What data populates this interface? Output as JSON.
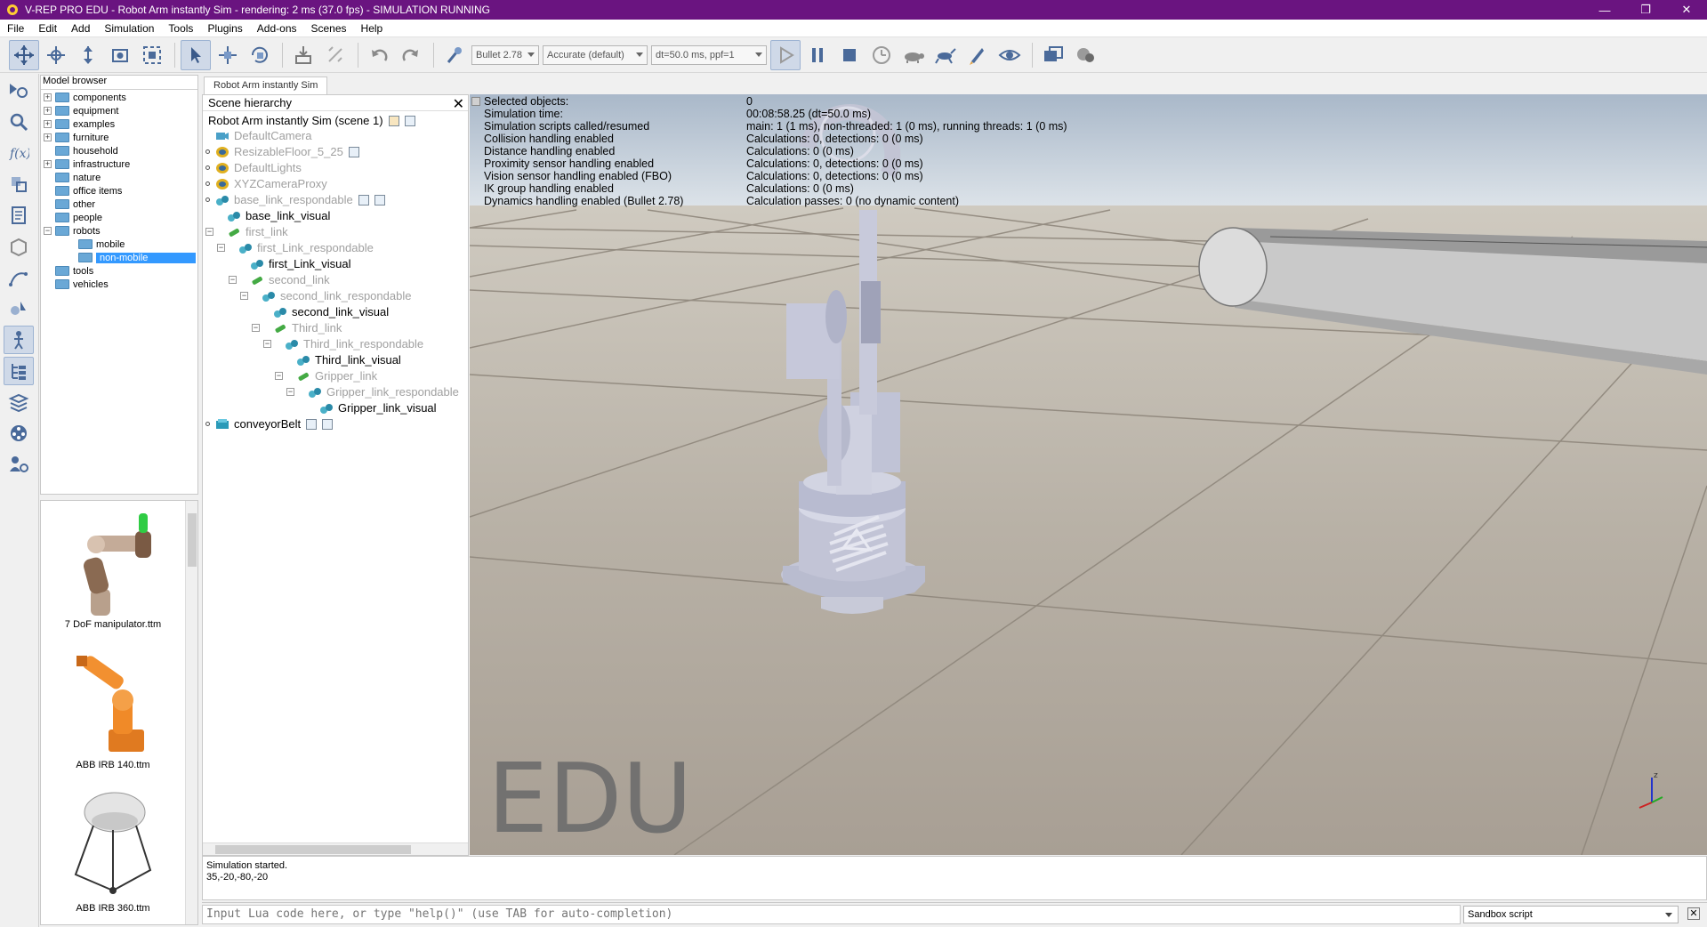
{
  "window": {
    "title": "V-REP PRO EDU - Robot Arm instantly Sim - rendering: 2 ms (37.0 fps) - SIMULATION RUNNING",
    "title_bar_color": "#6a1480"
  },
  "menu": {
    "items": [
      "File",
      "Edit",
      "Add",
      "Simulation",
      "Tools",
      "Plugins",
      "Add-ons",
      "Scenes",
      "Help"
    ]
  },
  "toolbar": {
    "engine": "Bullet 2.78",
    "accuracy": "Accurate (default)",
    "timestep": "dt=50.0 ms, ppf=1"
  },
  "model_browser": {
    "title": "Model browser",
    "folders": [
      {
        "label": "components",
        "expandable": true
      },
      {
        "label": "equipment",
        "expandable": true
      },
      {
        "label": "examples",
        "expandable": true
      },
      {
        "label": "furniture",
        "expandable": true
      },
      {
        "label": "household",
        "expandable": false
      },
      {
        "label": "infrastructure",
        "expandable": true
      },
      {
        "label": "nature",
        "expandable": false
      },
      {
        "label": "office items",
        "expandable": false
      },
      {
        "label": "other",
        "expandable": false
      },
      {
        "label": "people",
        "expandable": false
      },
      {
        "label": "robots",
        "expandable": true,
        "expanded": true
      },
      {
        "label": "mobile",
        "child": true
      },
      {
        "label": "non-mobile",
        "child": true,
        "selected": true
      },
      {
        "label": "tools",
        "expandable": false
      },
      {
        "label": "vehicles",
        "expandable": false
      }
    ],
    "thumbnails": [
      "7 DoF manipulator.ttm",
      "ABB IRB 140.ttm",
      "ABB IRB 360.ttm"
    ]
  },
  "scene": {
    "tab": "Robot Arm instantly Sim",
    "hierarchy_title": "Scene hierarchy",
    "root": "Robot Arm instantly Sim (scene 1)",
    "items": [
      {
        "label": "DefaultCamera",
        "dim": true
      },
      {
        "label": "ResizableFloor_5_25",
        "dim": true
      },
      {
        "label": "DefaultLights",
        "dim": true
      },
      {
        "label": "XYZCameraProxy",
        "dim": true
      },
      {
        "label": "base_link_respondable",
        "dim": true
      },
      {
        "label": "base_link_visual",
        "dim": false
      },
      {
        "label": "first_link",
        "dim": true
      },
      {
        "label": "first_Link_respondable",
        "dim": true
      },
      {
        "label": "first_Link_visual",
        "dim": false
      },
      {
        "label": "second_link",
        "dim": true
      },
      {
        "label": "second_link_respondable",
        "dim": true
      },
      {
        "label": "second_link_visual",
        "dim": false
      },
      {
        "label": "Third_link",
        "dim": true
      },
      {
        "label": "Third_link_respondable",
        "dim": true
      },
      {
        "label": "Third_link_visual",
        "dim": false
      },
      {
        "label": "Gripper_link",
        "dim": true
      },
      {
        "label": "Gripper_link_respondable",
        "dim": true
      },
      {
        "label": "Gripper_link_visual",
        "dim": false
      },
      {
        "label": "conveyorBelt",
        "dim": false
      }
    ]
  },
  "stats": [
    {
      "k": "Selected objects:",
      "v": "0"
    },
    {
      "k": "Simulation time:",
      "v": "00:08:58.25 (dt=50.0 ms)"
    },
    {
      "k": "Simulation scripts called/resumed",
      "v": "main: 1 (1 ms), non-threaded: 1 (0 ms), running threads: 1 (0 ms)"
    },
    {
      "k": "Collision handling enabled",
      "v": "Calculations: 0, detections: 0 (0 ms)"
    },
    {
      "k": "Distance handling enabled",
      "v": "Calculations: 0 (0 ms)"
    },
    {
      "k": "Proximity sensor handling enabled",
      "v": "Calculations: 0, detections: 0 (0 ms)"
    },
    {
      "k": "Vision sensor handling enabled (FBO)",
      "v": "Calculations: 0, detections: 0 (0 ms)"
    },
    {
      "k": "IK group handling enabled",
      "v": "Calculations: 0 (0 ms)"
    },
    {
      "k": "Dynamics handling enabled (Bullet 2.78)",
      "v": "Calculation passes: 0 (no dynamic content)"
    }
  ],
  "watermark": "EDU",
  "status": {
    "line1": "Simulation started.",
    "line2": "35,-20,-80,-20"
  },
  "lua": {
    "placeholder": "Input Lua code here, or type \"help()\" (use TAB for auto-completion)",
    "script_type": "Sandbox script"
  }
}
